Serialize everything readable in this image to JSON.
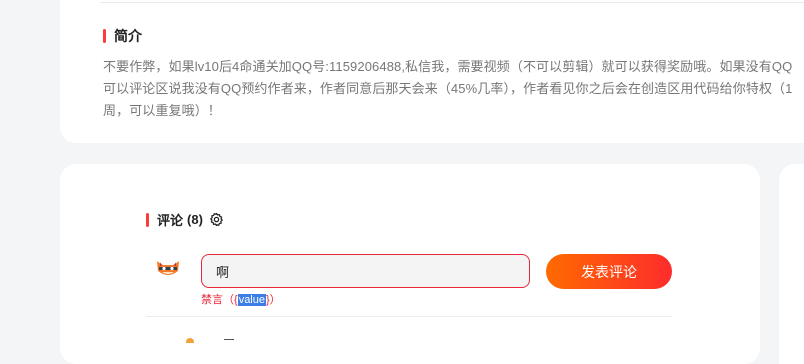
{
  "intro": {
    "heading": "简介",
    "text": "不要作弊，如果lv10后4命通关加QQ号:1159206488,私信我，需要视频（不可以剪辑）就可以获得奖励哦。如果没有QQ可以评论区说我没有QQ预约作者来，作者同意后那天会来（45%几率），作者看见你之后会在创造区用代码给你特权（1周，可以重复哦）！"
  },
  "comments": {
    "heading": "评论",
    "count": "(8)",
    "settings_icon": "gear-icon",
    "avatar_icon": "cat-avatar",
    "input_value": "啊",
    "error_prefix": "禁言（{",
    "error_highlight": "value",
    "error_suffix": "}）",
    "submit_label": "发表评论"
  },
  "colors": {
    "accent": "#fe3b3b",
    "error": "#e8283a",
    "button_gradient_start": "#ff6a00",
    "button_gradient_end": "#fe2c2c",
    "selection": "#3b7ee8"
  }
}
